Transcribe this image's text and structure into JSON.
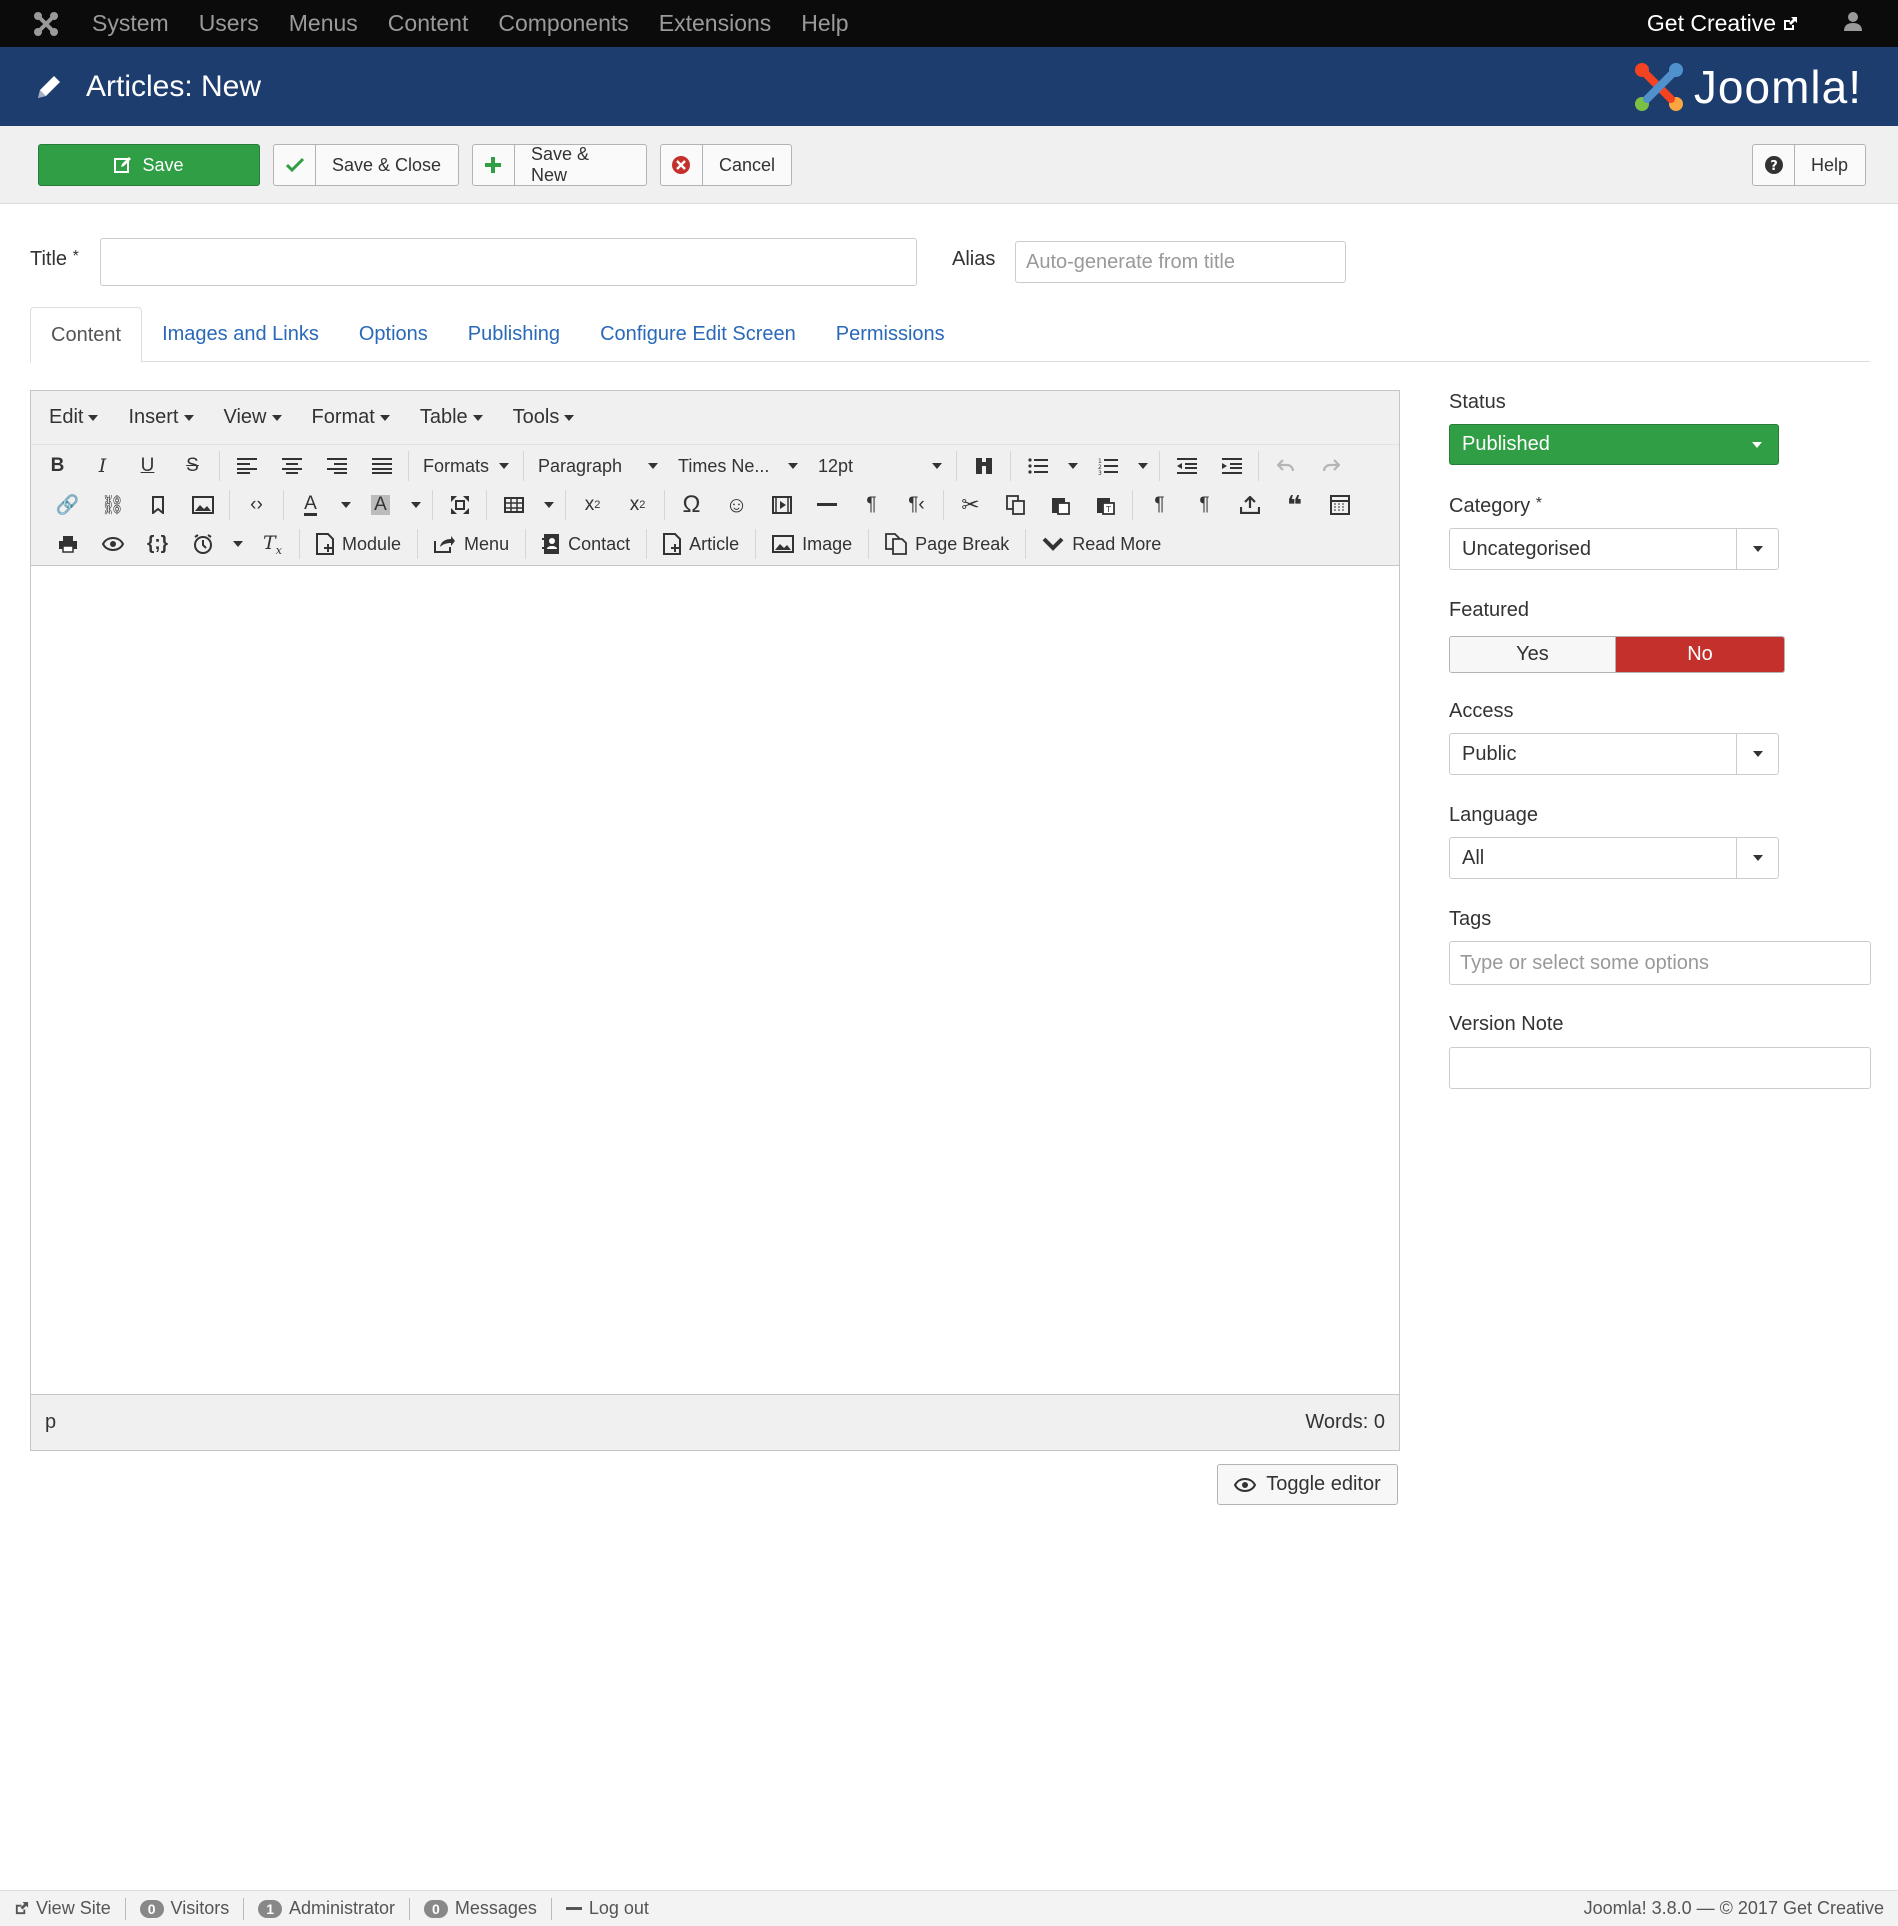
{
  "navbar": {
    "menu": [
      "System",
      "Users",
      "Menus",
      "Content",
      "Components",
      "Extensions",
      "Help"
    ],
    "site_link": "Get Creative"
  },
  "header": {
    "title": "Articles: New",
    "logo_word": "Joomla!"
  },
  "toolbar": {
    "save": "Save",
    "save_close": "Save & Close",
    "save_new": "Save & New",
    "cancel": "Cancel",
    "help": "Help"
  },
  "form": {
    "title_label": "Title",
    "required_mark": "*",
    "title_value": "",
    "alias_label": "Alias",
    "alias_placeholder": "Auto-generate from title"
  },
  "tabs": [
    "Content",
    "Images and Links",
    "Options",
    "Publishing",
    "Configure Edit Screen",
    "Permissions"
  ],
  "editor": {
    "menubar": [
      "Edit",
      "Insert",
      "View",
      "Format",
      "Table",
      "Tools"
    ],
    "formats": "Formats",
    "block": "Paragraph",
    "font": "Times Ne...",
    "size": "12pt",
    "buttons": [
      "Module",
      "Menu",
      "Contact",
      "Article",
      "Image",
      "Page Break",
      "Read More"
    ],
    "path": "p",
    "word_count": "Words: 0",
    "toggle": "Toggle editor"
  },
  "sidebar": {
    "status_label": "Status",
    "status_value": "Published",
    "category_label": "Category",
    "category_value": "Uncategorised",
    "featured_label": "Featured",
    "featured_yes": "Yes",
    "featured_no": "No",
    "access_label": "Access",
    "access_value": "Public",
    "language_label": "Language",
    "language_value": "All",
    "tags_label": "Tags",
    "tags_placeholder": "Type or select some options",
    "version_label": "Version Note"
  },
  "footer": {
    "view_site": "View Site",
    "visitors_count": "0",
    "visitors": "Visitors",
    "admin_count": "1",
    "admin": "Administrator",
    "messages_count": "0",
    "messages": "Messages",
    "logout": "Log out",
    "copyright": "Joomla! 3.8.0 — © 2017 Get Creative"
  },
  "colors": {
    "nav": "#0b0b0b",
    "header": "#1c3d6e",
    "success": "#2f9e44",
    "danger": "#c4302b",
    "link": "#2a69b8"
  }
}
